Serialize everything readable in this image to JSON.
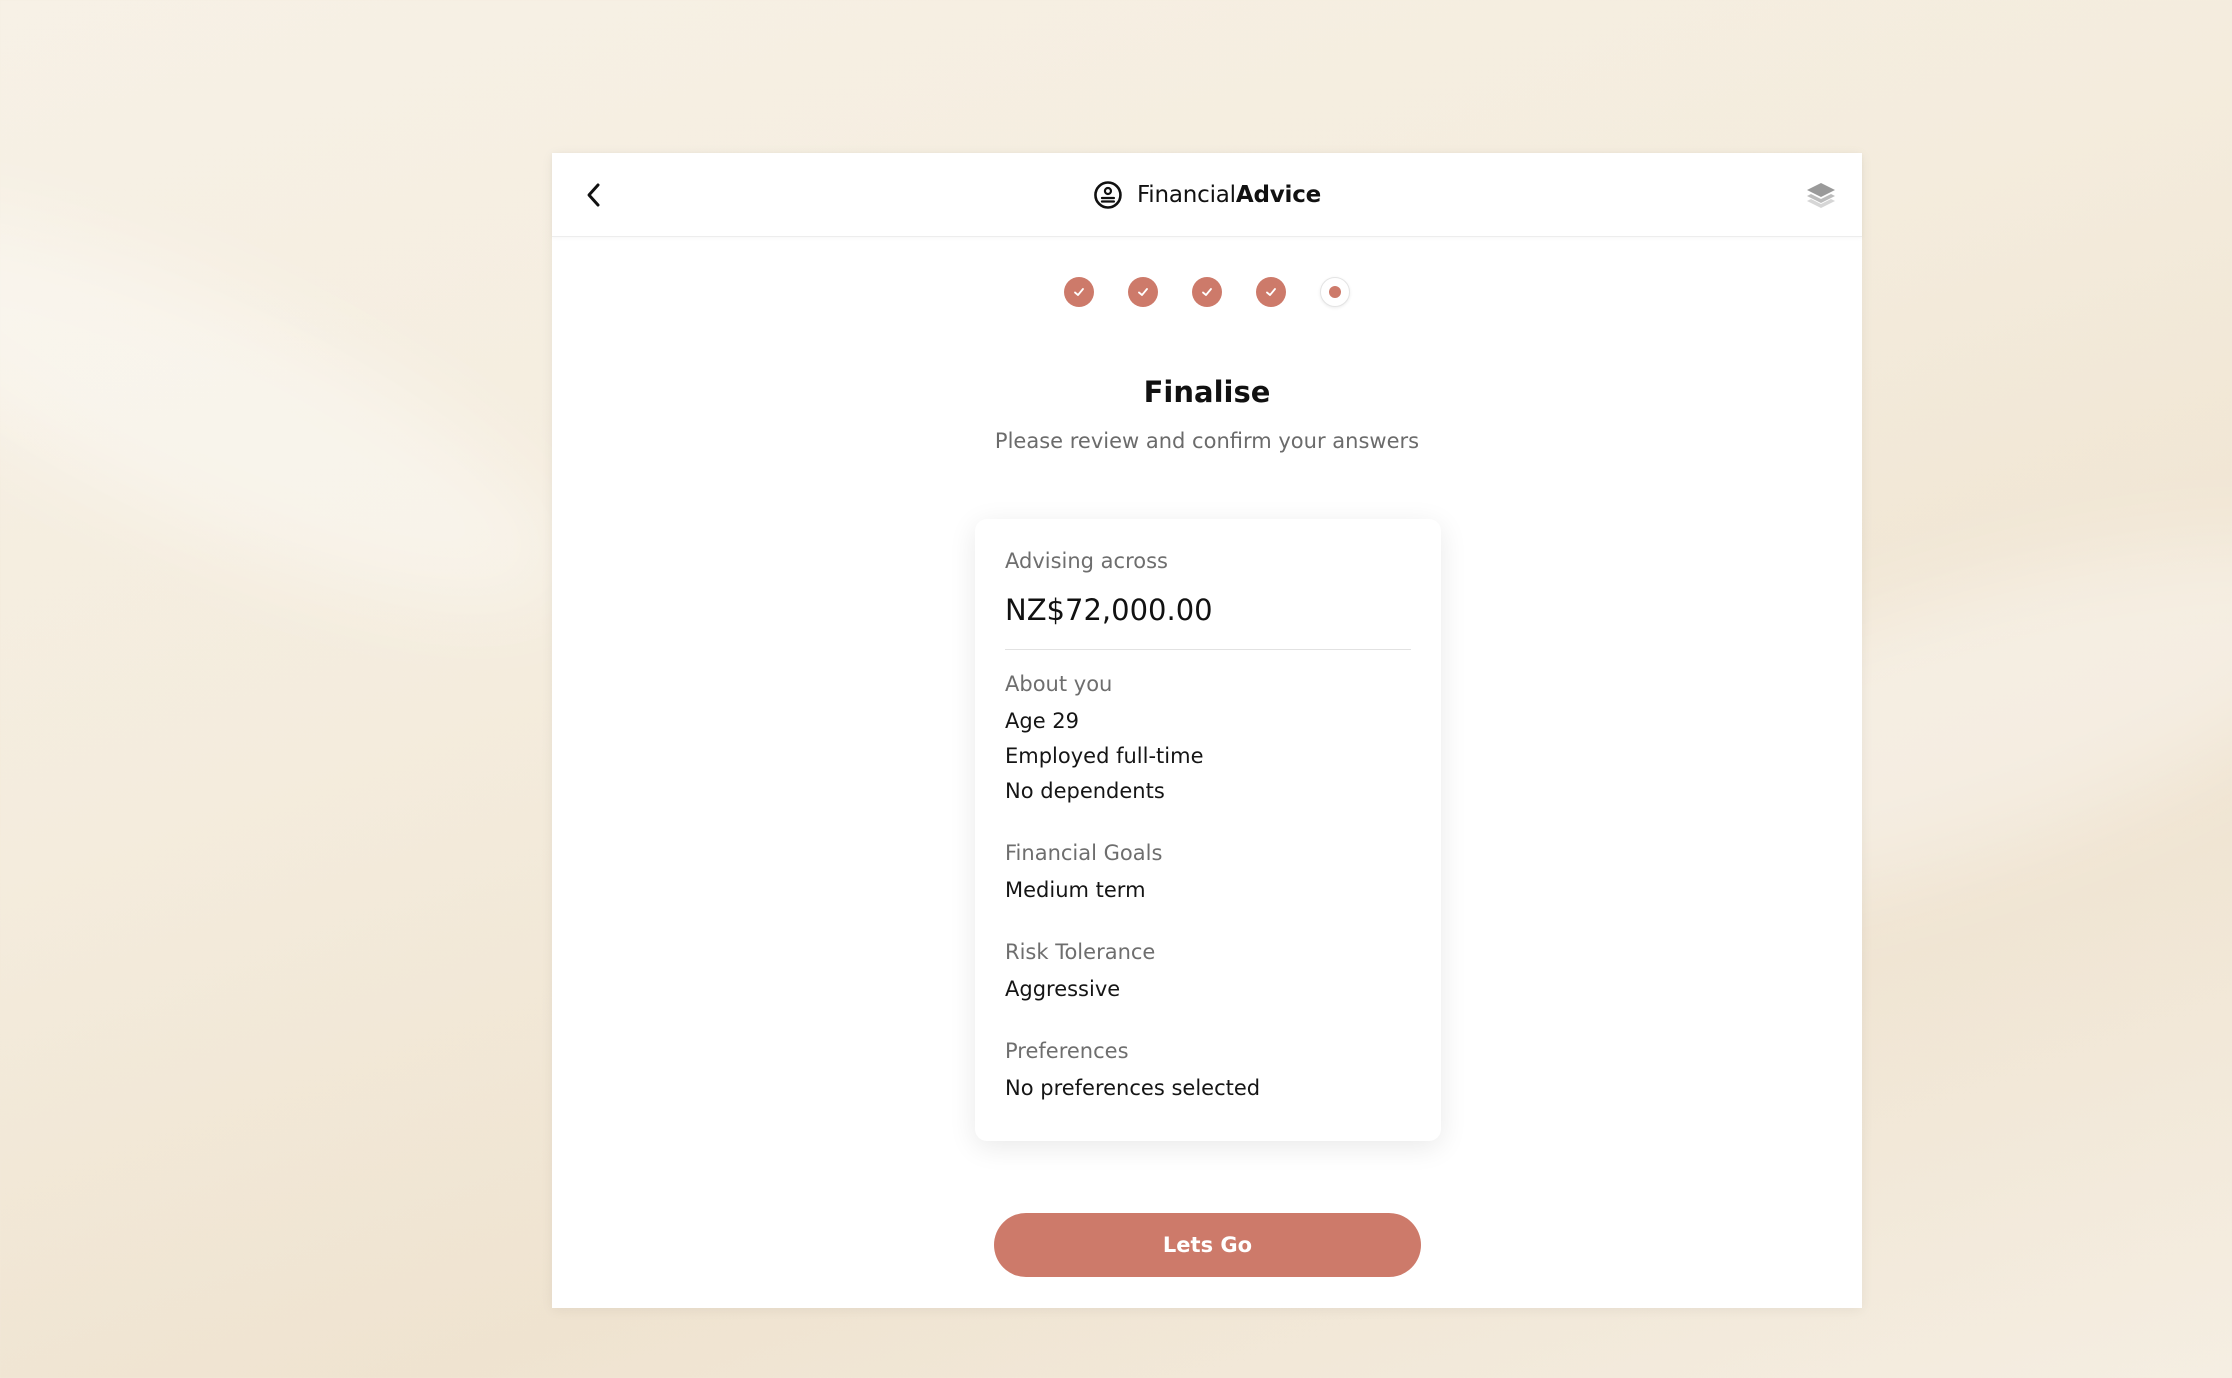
{
  "header": {
    "brand_regular": "Financial",
    "brand_bold": "Advice"
  },
  "stepper": {
    "total_steps": 5,
    "completed_steps": 4,
    "current_step": 5
  },
  "page": {
    "title": "Finalise",
    "subtitle": "Please review and confirm your answers"
  },
  "summary": {
    "advising_label": "Advising across",
    "advising_amount": "NZ$72,000.00",
    "sections": [
      {
        "label": "About you",
        "values": [
          "Age 29",
          "Employed full-time",
          "No dependents"
        ]
      },
      {
        "label": "Financial Goals",
        "values": [
          "Medium term"
        ]
      },
      {
        "label": "Risk Tolerance",
        "values": [
          "Aggressive"
        ]
      },
      {
        "label": "Preferences",
        "values": [
          "No preferences selected"
        ]
      }
    ]
  },
  "cta": {
    "label": "Lets Go"
  },
  "colors": {
    "accent": "#cd7a6a",
    "text_primary": "#111111",
    "text_secondary": "#6e6e6e"
  },
  "icons": {
    "back": "chevron-left-icon",
    "brand": "smiley-coin-icon",
    "layers": "layers-icon",
    "step_done": "check-icon"
  }
}
